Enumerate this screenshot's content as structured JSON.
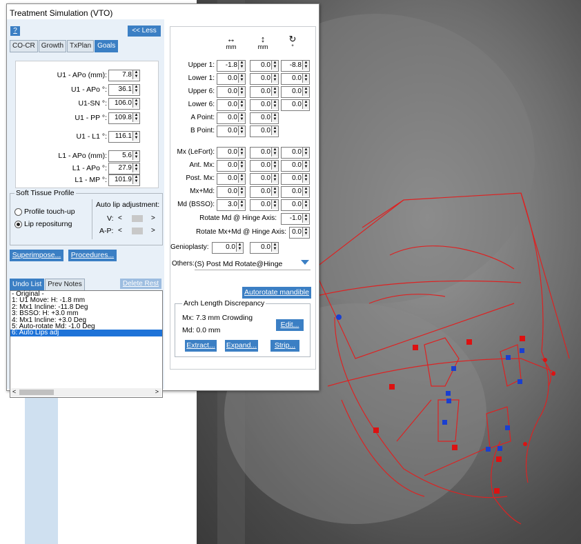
{
  "window": {
    "title": "Treatment Simulation (VTO)"
  },
  "top_buttons": {
    "help": "?",
    "less": "<< Less"
  },
  "tabs": [
    "CO-CR",
    "Growth",
    "TxPlan",
    "Goals"
  ],
  "goals": [
    {
      "label": "U1 - APo (mm):",
      "value": "7.8"
    },
    {
      "label": "U1 - APo °:",
      "value": "36.1"
    },
    {
      "label": "U1-SN °:",
      "value": "106.0"
    },
    {
      "label": "U1 - PP °:",
      "value": "109.8"
    },
    {
      "label": "U1 - L1 °:",
      "value": "116.1"
    },
    {
      "label": "L1 - APo (mm):",
      "value": "5.6"
    },
    {
      "label": "L1 - APo °:",
      "value": "27.9"
    },
    {
      "label": "L1 - MP °:",
      "value": "101.9"
    }
  ],
  "soft_tissue": {
    "legend": "Soft Tissue Profile",
    "option1": "Profile touch-up",
    "option2": "Lip repositurng",
    "auto_label": "Auto lip adjustment:",
    "v_label": "V:",
    "ap_label": "A-P:",
    "left": "<",
    "right": ">"
  },
  "buttons": {
    "superimpose": "Superimpose...",
    "procedures": "Procedures...",
    "delete": "Delete Rest"
  },
  "undo_tabs": [
    "Undo List",
    "Prev Notes"
  ],
  "undo_list": [
    "- Original -",
    "1:  U1 Move: H: -1.8 mm",
    "2:  Mx1 Incline: -11.8 Deg",
    "3:  BSSO: H: +3.0 mm",
    "4:  Mx1 Incline: +3.0 Deg",
    "5:  Auto-rotate Md: -1.0 Deg",
    "6:  Auto Lips adj"
  ],
  "scroll_arrows": {
    "left": "<",
    "right": ">"
  },
  "headers": {
    "h_icon": "↔",
    "v_icon": "↕",
    "r_icon": "↻",
    "unit_mm": "mm",
    "unit_deg": "°"
  },
  "movement_rows": [
    {
      "label": "Upper 1:",
      "h": "-1.8",
      "v": "0.0",
      "r": "-8.8"
    },
    {
      "label": "Lower 1:",
      "h": "0.0",
      "v": "0.0",
      "r": "0.0"
    },
    {
      "label": "Upper 6:",
      "h": "0.0",
      "v": "0.0",
      "r": "0.0"
    },
    {
      "label": "Lower 6:",
      "h": "0.0",
      "v": "0.0",
      "r": "0.0"
    },
    {
      "label": "A Point:",
      "h": "0.0",
      "v": "0.0"
    },
    {
      "label": "B Point:",
      "h": "0.0",
      "v": "0.0"
    }
  ],
  "surgery_rows": [
    {
      "label": "Mx (LeFort):",
      "h": "0.0",
      "v": "0.0",
      "r": "0.0"
    },
    {
      "label": "Ant. Mx:",
      "h": "0.0",
      "v": "0.0",
      "r": "0.0"
    },
    {
      "label": "Post. Mx:",
      "h": "0.0",
      "v": "0.0",
      "r": "0.0"
    },
    {
      "label": "Mx+Md:",
      "h": "0.0",
      "v": "0.0",
      "r": "0.0"
    },
    {
      "label": "Md (BSSO):",
      "h": "3.0",
      "v": "0.0",
      "r": "0.0"
    }
  ],
  "hinge": [
    {
      "label": "Rotate Md @ Hinge Axis:",
      "value": "-1.0"
    },
    {
      "label": "Rotate Mx+Md @ Hinge Axis:",
      "value": "0.0"
    }
  ],
  "genioplasty": {
    "label": "Genioplasty:",
    "h": "0.0",
    "v": "0.0"
  },
  "others": {
    "label": "Others:",
    "value": "(S) Post Md Rotate@Hinge"
  },
  "autorotate": "Autorotate mandible",
  "arch": {
    "legend": "Arch Length Discrepancy",
    "mx": "Mx:  7.3 mm Crowding",
    "md": "Md:  0.0 mm",
    "edit": "Edit...",
    "extract": "Extract...",
    "expand": "Expand...",
    "strip": "Strip..."
  }
}
